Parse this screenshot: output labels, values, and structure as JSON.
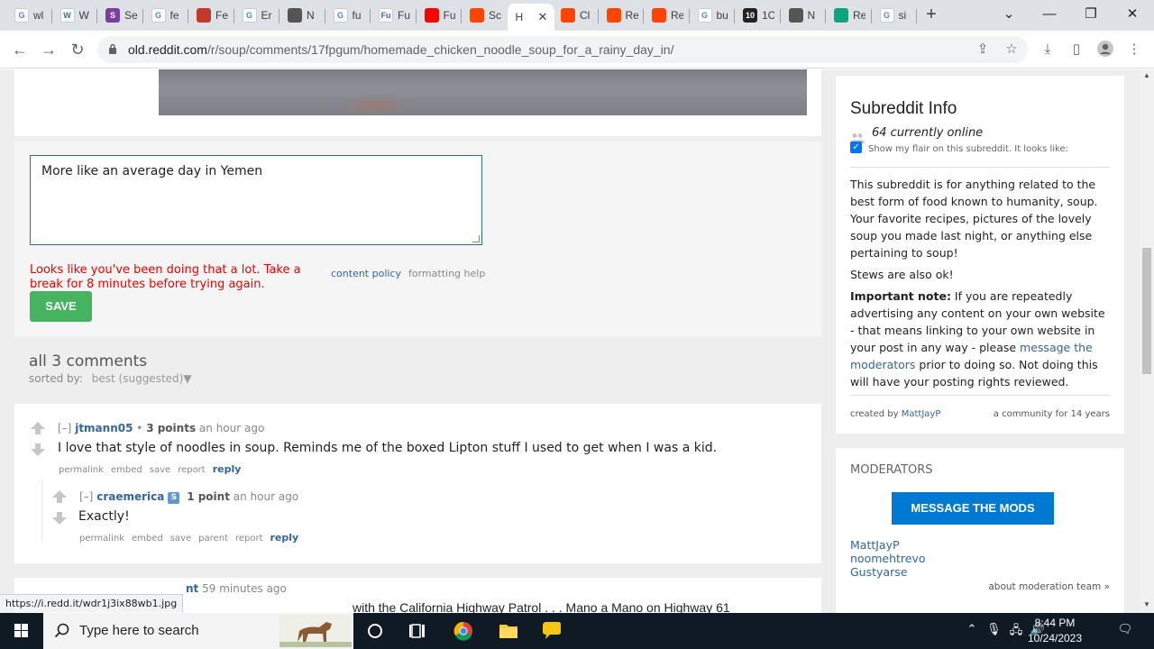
{
  "browser": {
    "tabs": [
      {
        "fav": "G",
        "title": "wl",
        "color": "#ffffff",
        "fg": "#4285f4"
      },
      {
        "fav": "W",
        "title": "W",
        "color": "#ffffff",
        "fg": "#21759b"
      },
      {
        "fav": "S",
        "title": "Se",
        "color": "#7b3fa0",
        "fg": "#ffffff"
      },
      {
        "fav": "G",
        "title": "fe",
        "color": "#ffffff",
        "fg": "#4285f4"
      },
      {
        "fav": "",
        "title": "Fe",
        "color": "#c0392b",
        "fg": "#ffffff"
      },
      {
        "fav": "G",
        "title": "Er",
        "color": "#ffffff",
        "fg": "#4285f4"
      },
      {
        "fav": "",
        "title": "N",
        "color": "#555555",
        "fg": "#ffffff"
      },
      {
        "fav": "G",
        "title": "fu",
        "color": "#ffffff",
        "fg": "#4285f4"
      },
      {
        "fav": "Fu",
        "title": "Fu",
        "color": "#ffffff",
        "fg": "#2d6cdf"
      },
      {
        "fav": "",
        "title": "Fu",
        "color": "#ff0000",
        "fg": "#ffffff"
      },
      {
        "fav": "",
        "title": "Sc",
        "color": "#ff4500",
        "fg": "#ffffff"
      },
      {
        "fav": "",
        "title": "H",
        "color": "#ffffff",
        "fg": "#ffffff",
        "active": true
      },
      {
        "fav": "",
        "title": "Cl",
        "color": "#ff4500",
        "fg": "#ffffff"
      },
      {
        "fav": "",
        "title": "Re",
        "color": "#ff4500",
        "fg": "#ffffff"
      },
      {
        "fav": "",
        "title": "Re",
        "color": "#ff4500",
        "fg": "#ffffff"
      },
      {
        "fav": "G",
        "title": "bu",
        "color": "#ffffff",
        "fg": "#4285f4"
      },
      {
        "fav": "10",
        "title": "1C",
        "color": "#222222",
        "fg": "#ffffff"
      },
      {
        "fav": "",
        "title": "N",
        "color": "#555555",
        "fg": "#ffffff"
      },
      {
        "fav": "",
        "title": "Re",
        "color": "#10a37f",
        "fg": "#ffffff"
      },
      {
        "fav": "G",
        "title": "si",
        "color": "#ffffff",
        "fg": "#4285f4"
      }
    ],
    "url_domain": "old.reddit.com",
    "url_path": "/r/soup/comments/17fpgum/homemade_chicken_noodle_soup_for_a_rainy_day_in/"
  },
  "reply_form": {
    "text": "More like an average day in Yemen",
    "error": "Looks like you've been doing that a lot. Take a break for 8 minutes before trying again.",
    "content_policy": "content policy",
    "formatting_help": "formatting help",
    "save_label": "SAVE"
  },
  "comments_section": {
    "header": "all 3 comments",
    "sorted_by_label": "sorted by:",
    "sorted_by_value": "best (suggested)",
    "comments": [
      {
        "collapse": "[–]",
        "author": "jtmann05",
        "score": "3 points",
        "time": "an hour ago",
        "body": "I love that style of noodles in soup. Reminds me of the boxed Lipton stuff I used to get when I was a kid.",
        "buttons": [
          "permalink",
          "embed",
          "save",
          "report"
        ],
        "reply": "reply"
      },
      {
        "collapse": "[–]",
        "author": "craemerica",
        "flair": "S",
        "score": "1 point",
        "time": "an hour ago",
        "body": "Exactly!",
        "buttons": [
          "permalink",
          "embed",
          "save",
          "parent",
          "report"
        ],
        "reply": "reply"
      }
    ],
    "next": {
      "time": "59 minutes ago",
      "title_fragment": "with the California Highway Patrol . . . Mano a Mano on Highway 61"
    }
  },
  "sidebar": {
    "title": "Subreddit Info",
    "online": "64 currently online",
    "flair_label": "Show my flair on this subreddit. It looks like:",
    "description": "This subreddit is for anything related to the best form of food known to humanity, soup. Your favorite recipes, pictures of the lovely soup you made last night, or anything else pertaining to soup!",
    "stews": "Stews are also ok!",
    "note_bold": "Important note:",
    "note_text_1": " If you are repeatedly advertising any content on your own website - that means linking to your own website in your post in any way - please ",
    "note_link": "message the moderators",
    "note_text_2": " prior to doing so. Not doing this will have your posting rights reviewed.",
    "created_by_label": "created by",
    "created_by": "MattJayP",
    "community_age": "a community for 14 years",
    "moderators_title": "MODERATORS",
    "message_mods_label": "MESSAGE THE MODS",
    "moderators": [
      "MattJayP",
      "noomehtrevo",
      "Gustyarse"
    ],
    "about_team": "about moderation team »"
  },
  "status_url": "https://i.redd.it/wdr1j3ix88wb1.jpg",
  "taskbar": {
    "search_placeholder": "Type here to search",
    "time": "8:44 PM",
    "date": "10/24/2023"
  }
}
